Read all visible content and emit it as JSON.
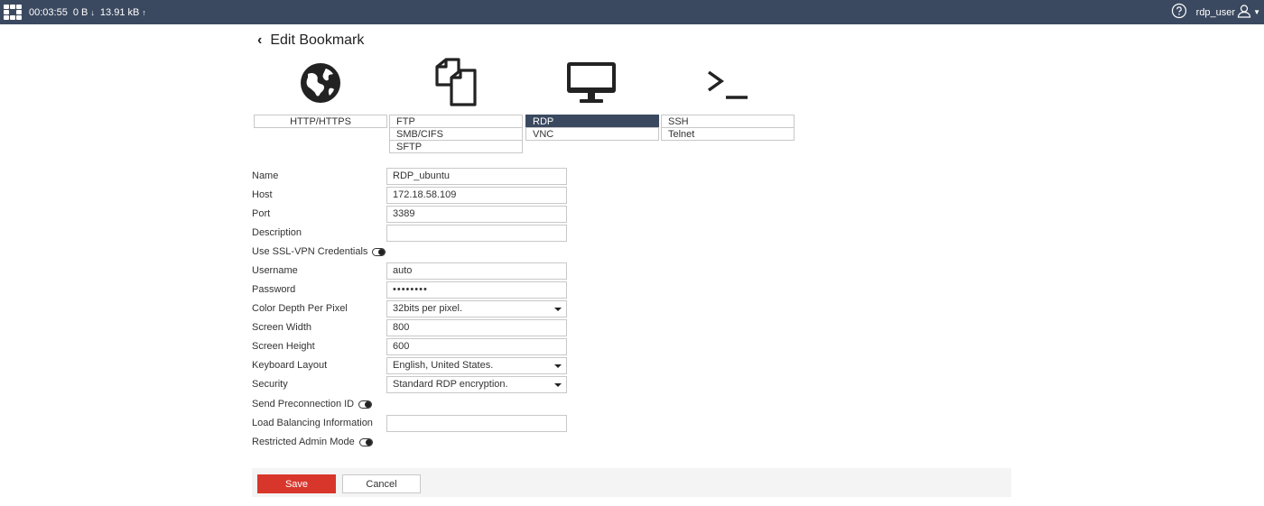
{
  "topbar": {
    "timer": "00:03:55",
    "download": "0 B",
    "upload": "13.91 kB",
    "user": "rdp_user",
    "icons": [
      "fortinet-logo-icon",
      "arrow-down-icon",
      "arrow-up-icon",
      "help-icon",
      "user-icon",
      "chevron-down-icon"
    ]
  },
  "page": {
    "back_icon": "chevron-left-icon",
    "title": "Edit Bookmark"
  },
  "type_icons": [
    "globe-icon",
    "files-icon",
    "monitor-icon",
    "terminal-icon"
  ],
  "protocols": {
    "web": [
      "HTTP/HTTPS"
    ],
    "file": [
      "FTP",
      "SMB/CIFS",
      "SFTP"
    ],
    "remote_desktop": [
      "RDP",
      "VNC"
    ],
    "shell": [
      "SSH",
      "Telnet"
    ],
    "selected": "RDP"
  },
  "form": {
    "name": {
      "label": "Name",
      "value": "RDP_ubuntu"
    },
    "host": {
      "label": "Host",
      "value": "172.18.58.109"
    },
    "port": {
      "label": "Port",
      "value": "3389"
    },
    "description": {
      "label": "Description",
      "value": ""
    },
    "use_ssl_vpn": {
      "label": "Use SSL-VPN Credentials"
    },
    "username": {
      "label": "Username",
      "value": "auto"
    },
    "password": {
      "label": "Password",
      "value": "••••••••"
    },
    "color_depth": {
      "label": "Color Depth Per Pixel",
      "value": "32bits per pixel."
    },
    "screen_width": {
      "label": "Screen Width",
      "value": "800"
    },
    "screen_height": {
      "label": "Screen Height",
      "value": "600"
    },
    "keyboard_layout": {
      "label": "Keyboard Layout",
      "value": "English, United States."
    },
    "security": {
      "label": "Security",
      "value": "Standard RDP encryption."
    },
    "send_preconnection": {
      "label": "Send Preconnection ID"
    },
    "load_balancing": {
      "label": "Load Balancing Information",
      "value": ""
    },
    "restricted_admin": {
      "label": "Restricted Admin Mode"
    }
  },
  "actions": {
    "save": "Save",
    "cancel": "Cancel"
  },
  "colors": {
    "topbar": "#3b4960",
    "selected_protocol": "#3b4960",
    "save_button": "#d9362b"
  }
}
